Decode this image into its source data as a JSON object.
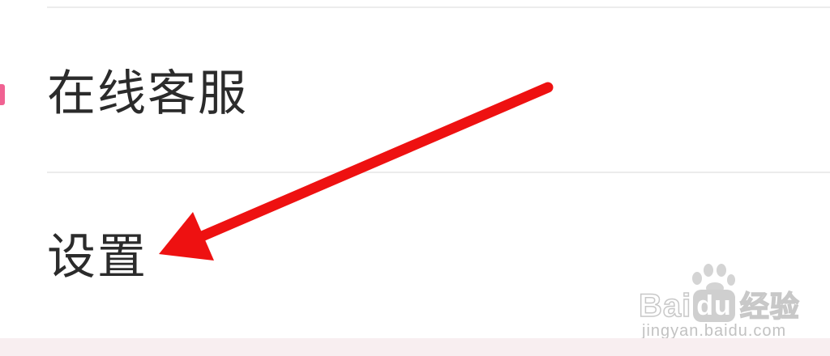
{
  "menu": {
    "items": [
      {
        "label": "在线客服"
      },
      {
        "label": "设置"
      }
    ]
  },
  "annotation": {
    "arrow_color": "#ee1111",
    "arrow_points_to": "设置"
  },
  "watermark": {
    "logo_text_1": "Bai",
    "logo_text_2": "du",
    "logo_text_3": "经验",
    "url": "jingyan.baidu.com"
  },
  "colors": {
    "accent": "#f06292",
    "divider": "#ececec",
    "text": "#2b2b2b",
    "footer": "#f8eef0"
  }
}
